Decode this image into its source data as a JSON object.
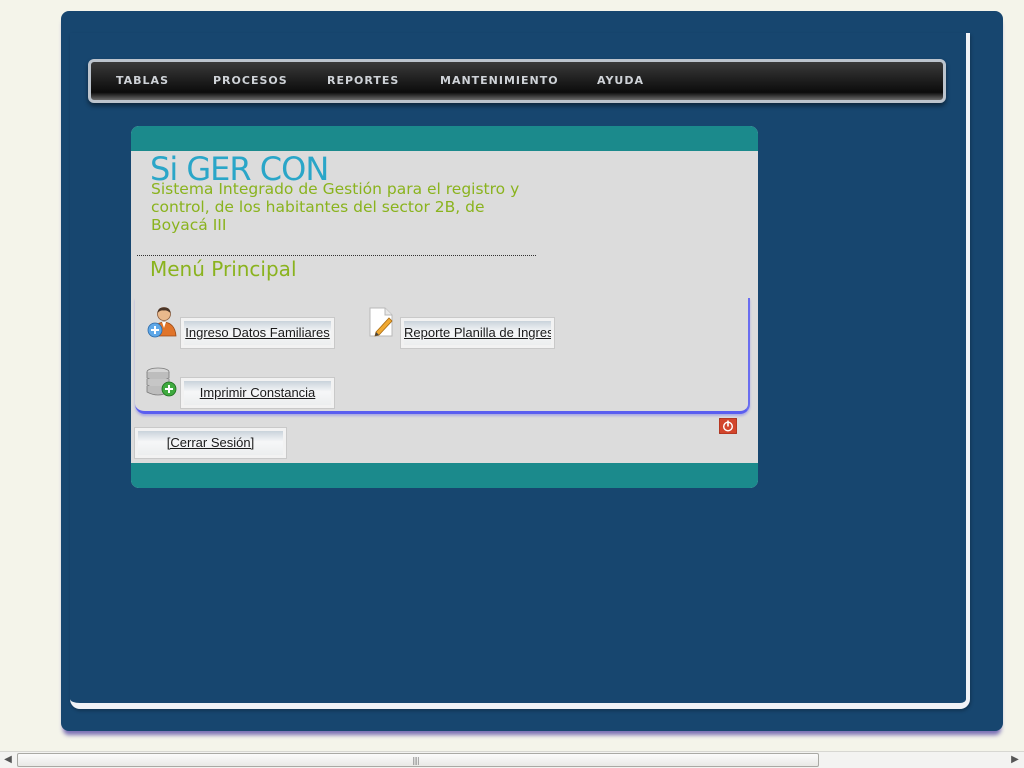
{
  "nav": {
    "items": [
      {
        "label": "TABLAS"
      },
      {
        "label": "PROCESOS"
      },
      {
        "label": "REPORTES"
      },
      {
        "label": "MANTENIMIENTO"
      },
      {
        "label": "AYUDA"
      }
    ]
  },
  "header": {
    "title": "Si GER CON",
    "subtitle": "Sistema Integrado de Gestión para el registro y control, de los habitantes del sector 2B, de Boyacá III"
  },
  "menu": {
    "heading": "Menú Principal",
    "buttons": {
      "ingreso": "Ingreso Datos Familiares",
      "reporte": "Reporte Planilla de Ingreso",
      "constancia": "Imprimir Constancia"
    }
  },
  "session": {
    "logout_label": "[Cerrar Sesión]"
  },
  "icons": {
    "ingreso": "add-user-icon",
    "reporte": "edit-document-icon",
    "constancia": "add-database-icon",
    "power": "power-icon"
  },
  "colors": {
    "page_bg": "#f4f4ea",
    "frame_bg": "#17466f",
    "panel_band": "#1b8a8c",
    "panel_bg": "#dcdcdc",
    "title_blue": "#2aa6c8",
    "accent_green": "#8ab31e",
    "menu_border": "#5a5ef0"
  }
}
